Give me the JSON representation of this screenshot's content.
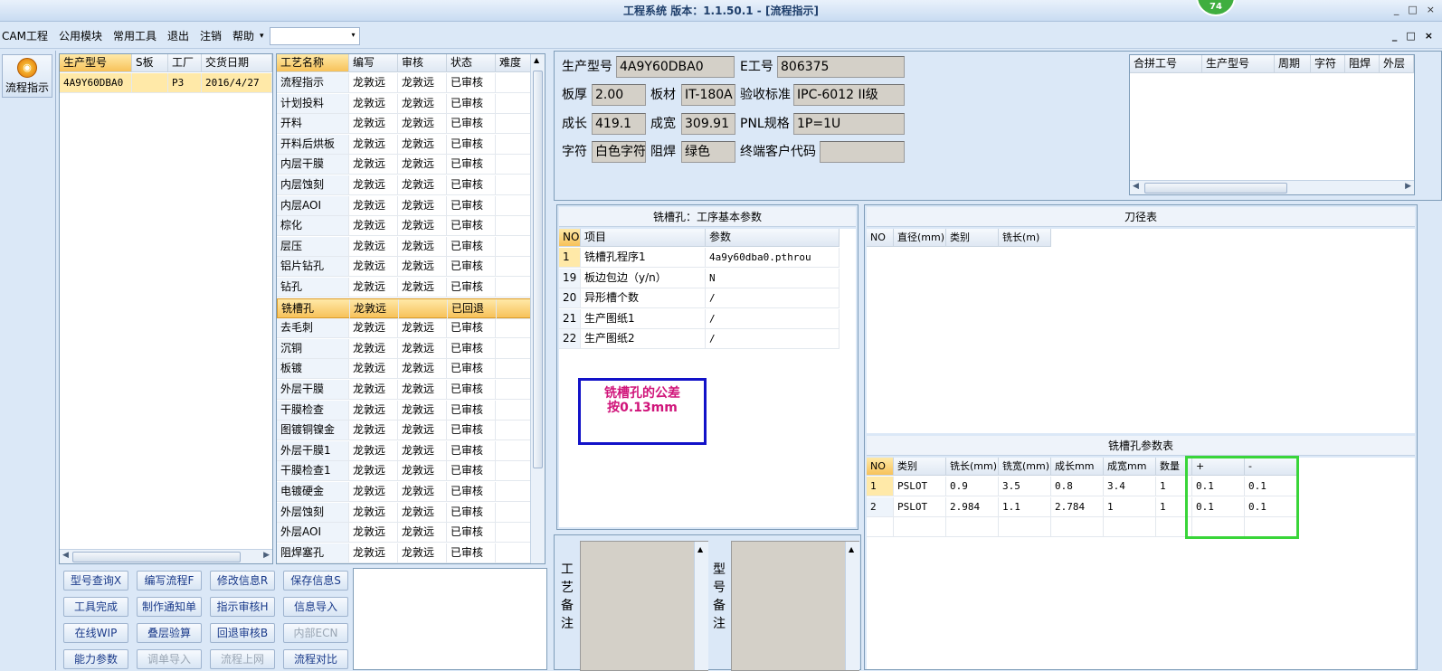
{
  "window": {
    "title": "工程系统  版本：1.1.50.1 - [流程指示]",
    "badge": "74",
    "controls": [
      "_",
      "□",
      "×"
    ]
  },
  "menu": {
    "items": [
      "CAM工程",
      "公用模块",
      "常用工具",
      "退出",
      "注销",
      "帮助"
    ],
    "dropdown_arrow": "▾",
    "combo_value": "",
    "mdi_controls": [
      "_",
      "□",
      "×"
    ]
  },
  "nav": {
    "button_label": "流程指示"
  },
  "orders": {
    "headers": [
      "生产型号",
      "S板",
      "工厂",
      "交货日期"
    ],
    "rows": [
      [
        "4A9Y60DBA0",
        "",
        "P3",
        "2016/4/27"
      ]
    ]
  },
  "process": {
    "headers": [
      "工艺名称",
      "编写",
      "审核",
      "状态",
      "难度"
    ],
    "rows": [
      [
        "流程指示",
        "龙敦远",
        "龙敦远",
        "已审核",
        ""
      ],
      [
        "计划投料",
        "龙敦远",
        "龙敦远",
        "已审核",
        ""
      ],
      [
        "开料",
        "龙敦远",
        "龙敦远",
        "已审核",
        ""
      ],
      [
        "开料后烘板",
        "龙敦远",
        "龙敦远",
        "已审核",
        ""
      ],
      [
        "内层干膜",
        "龙敦远",
        "龙敦远",
        "已审核",
        ""
      ],
      [
        "内层蚀刻",
        "龙敦远",
        "龙敦远",
        "已审核",
        ""
      ],
      [
        "内层AOI",
        "龙敦远",
        "龙敦远",
        "已审核",
        ""
      ],
      [
        "棕化",
        "龙敦远",
        "龙敦远",
        "已审核",
        ""
      ],
      [
        "层压",
        "龙敦远",
        "龙敦远",
        "已审核",
        ""
      ],
      [
        "铝片钻孔",
        "龙敦远",
        "龙敦远",
        "已审核",
        ""
      ],
      [
        "钻孔",
        "龙敦远",
        "龙敦远",
        "已审核",
        ""
      ],
      [
        "铣槽孔",
        "龙敦远",
        "",
        "已回退",
        ""
      ],
      [
        "去毛刺",
        "龙敦远",
        "龙敦远",
        "已审核",
        ""
      ],
      [
        "沉铜",
        "龙敦远",
        "龙敦远",
        "已审核",
        ""
      ],
      [
        "板镀",
        "龙敦远",
        "龙敦远",
        "已审核",
        ""
      ],
      [
        "外层干膜",
        "龙敦远",
        "龙敦远",
        "已审核",
        ""
      ],
      [
        "干膜检查",
        "龙敦远",
        "龙敦远",
        "已审核",
        ""
      ],
      [
        "图镀铜镍金",
        "龙敦远",
        "龙敦远",
        "已审核",
        ""
      ],
      [
        "外层干膜1",
        "龙敦远",
        "龙敦远",
        "已审核",
        ""
      ],
      [
        "干膜检查1",
        "龙敦远",
        "龙敦远",
        "已审核",
        ""
      ],
      [
        "电镀硬金",
        "龙敦远",
        "龙敦远",
        "已审核",
        ""
      ],
      [
        "外层蚀刻",
        "龙敦远",
        "龙敦远",
        "已审核",
        ""
      ],
      [
        "外层AOI",
        "龙敦远",
        "龙敦远",
        "已审核",
        ""
      ],
      [
        "阻焊塞孔",
        "龙敦远",
        "龙敦远",
        "已审核",
        ""
      ]
    ],
    "selected_index": 11
  },
  "buttons": [
    [
      "型号查询X",
      "编写流程F",
      "修改信息R",
      "保存信息S"
    ],
    [
      "工具完成",
      "制作通知单",
      "指示审核H",
      "信息导入"
    ],
    [
      "在线WIP",
      "叠层验算",
      "回退审核B",
      "内部ECN"
    ],
    [
      "能力参数",
      "调单导入",
      "流程上网",
      "流程对比"
    ]
  ],
  "buttons_disabled": [
    "内部ECN",
    "调单导入",
    "流程上网"
  ],
  "info": {
    "model_label": "生产型号",
    "model": "4A9Y60DBA0",
    "eno_label": "E工号",
    "eno": "806375",
    "thick_label": "板厚",
    "thick": "2.00",
    "material_label": "板材",
    "material": "IT-180A",
    "std_label": "验收标准",
    "std": "IPC-6012 II级",
    "len_label": "成长",
    "len": "419.1",
    "width_label": "成宽",
    "width": "309.91",
    "pnl_label": "PNL规格",
    "pnl": "1P=1U",
    "char_label": "字符",
    "char": "白色字符",
    "mask_label": "阻焊",
    "mask": "绿色",
    "cust_label": "终端客户代码",
    "cust": ""
  },
  "merge": {
    "headers": [
      "合拼工号",
      "生产型号",
      "周期",
      "字符",
      "阻焊",
      "外层"
    ]
  },
  "params": {
    "title": "铣槽孔：工序基本参数",
    "headers": [
      "NO",
      "项目",
      "参数"
    ],
    "rows": [
      [
        "1",
        "铣槽孔程序1",
        "4a9y60dba0.pthrou"
      ],
      [
        "19",
        "板边包边（y/n）",
        "N"
      ],
      [
        "20",
        "异形槽个数",
        "/"
      ],
      [
        "21",
        "生产图纸1",
        "/"
      ],
      [
        "22",
        "生产图纸2",
        "/"
      ]
    ],
    "note_line1": "铣槽孔的公差",
    "note_line2": "按0.13mm"
  },
  "tools": {
    "title": "刀径表",
    "headers": [
      "NO",
      "直径(mm)",
      "类别",
      "铣长(m)"
    ]
  },
  "slots": {
    "title": "铣槽孔参数表",
    "headers": [
      "NO",
      "类别",
      "铣长(mm)",
      "铣宽(mm)",
      "成长mm",
      "成宽mm",
      "数量",
      "+",
      "-"
    ],
    "rows": [
      [
        "1",
        "PSLOT",
        "0.9",
        "3.5",
        "0.8",
        "3.4",
        "1",
        "0.1",
        "0.1"
      ],
      [
        "2",
        "PSLOT",
        "2.984",
        "1.1",
        "2.784",
        "1",
        "1",
        "0.1",
        "0.1"
      ]
    ]
  },
  "remarks": {
    "process_label": "工艺备注",
    "model_label": "型号备注"
  },
  "colors": {
    "highlight_green": "#39d539",
    "note_border": "#1212c8",
    "note_text": "#d0147a"
  }
}
